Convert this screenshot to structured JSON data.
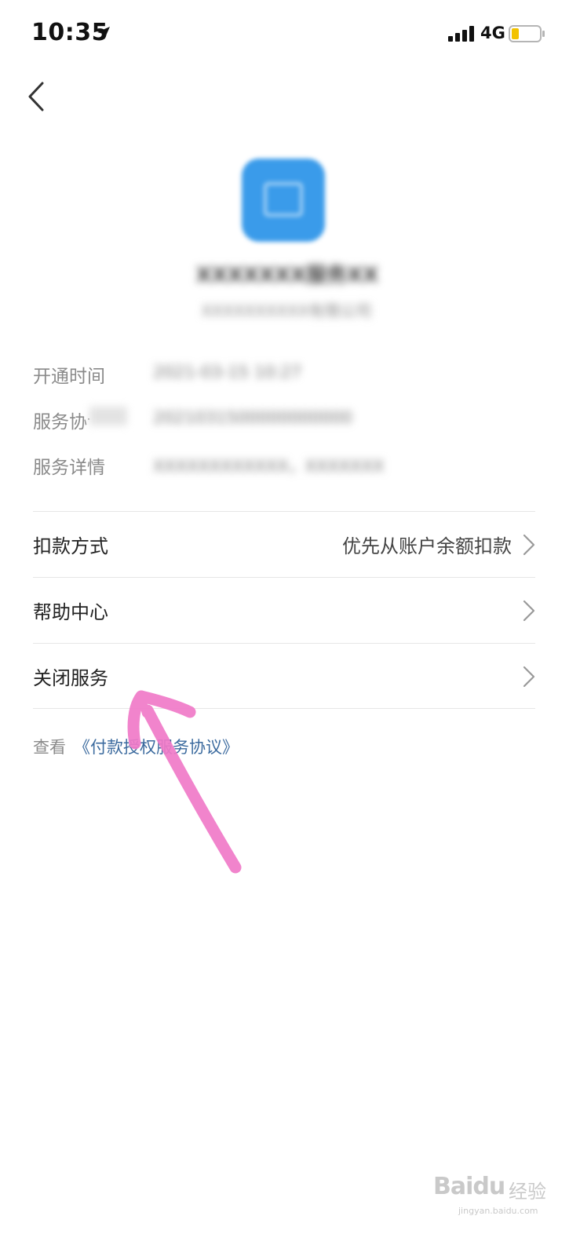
{
  "status_bar": {
    "time": "10:35",
    "network": "4G"
  },
  "header": {
    "merchant_name": "XXXXXXX服务XX",
    "merchant_full": "XXXXXXXXXX有限公司"
  },
  "info": [
    {
      "label": "开通时间",
      "value": "2021-03-15 10:27"
    },
    {
      "label": "服务协议号",
      "value": "2021031500000000000"
    },
    {
      "label": "服务详情",
      "value": "XXXXXXXXXXXX，XXXXXXX"
    }
  ],
  "rows": [
    {
      "label": "扣款方式",
      "value": "优先从账户余额扣款"
    },
    {
      "label": "帮助中心",
      "value": ""
    },
    {
      "label": "关闭服务",
      "value": ""
    }
  ],
  "agreement": {
    "prefix": "查看",
    "link": "《付款授权服务协议》"
  },
  "watermark": {
    "brand": "Baidu",
    "cn": "经验",
    "url": "jingyan.baidu.com"
  },
  "colors": {
    "link": "#3b6a9e",
    "logo": "#3a9bea",
    "annotation": "#f07ac8"
  }
}
